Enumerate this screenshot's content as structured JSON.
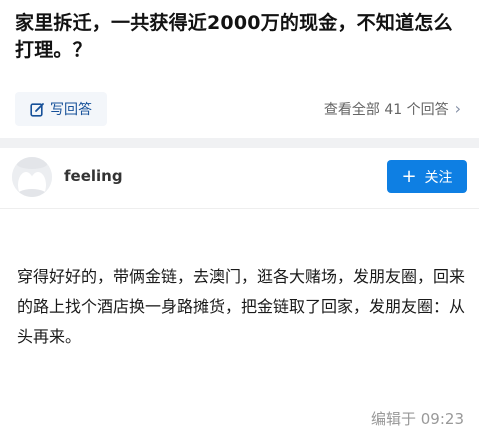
{
  "question": {
    "title": "家里拆迁，一共获得近2000万的现金，不知道怎么打理。？"
  },
  "actions": {
    "write_answer_label": "写回答",
    "view_all_label": "查看全部 41 个回答"
  },
  "author": {
    "name": "feeling",
    "follow_label": "关注"
  },
  "answer": {
    "content": "穿得好好的，带俩金链，去澳门，逛各大赌场，发朋友圈，回来的路上找个酒店换一身路摊货，把金链取了回家，发朋友圈：从头再来。",
    "edit_time": "编辑于 09:23"
  },
  "icons": {
    "write": "edit-icon",
    "chevron": "chevron-right-icon",
    "plus": "plus-icon",
    "avatar": "default-avatar-icon"
  },
  "colors": {
    "link_blue": "#175199",
    "follow_blue": "#0e7fe3",
    "muted_gray": "#999999"
  }
}
